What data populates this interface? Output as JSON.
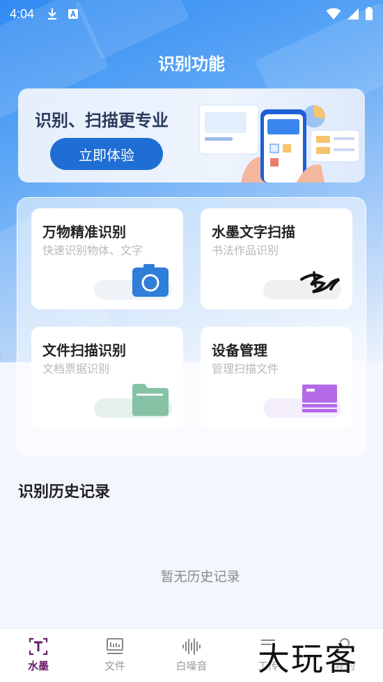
{
  "status_bar": {
    "time": "4:04",
    "left_icons": [
      "download-icon",
      "app-a-icon"
    ],
    "right_icons": [
      "wifi-icon",
      "signal-icon",
      "battery-icon"
    ]
  },
  "header": {
    "title": "识别功能"
  },
  "banner": {
    "title": "识别、扫描更专业",
    "button_label": "立即体验"
  },
  "features": [
    {
      "title": "万物精准识别",
      "subtitle": "快速识别物体、文字",
      "icon": "camera-icon",
      "accent": "#2f7ed8"
    },
    {
      "title": "水墨文字扫描",
      "subtitle": "书法作品识别",
      "icon": "ink-brush-icon",
      "accent": "#111111"
    },
    {
      "title": "文件扫描识别",
      "subtitle": "文档票据识别",
      "icon": "folder-icon",
      "accent": "#86c2a6"
    },
    {
      "title": "设备管理",
      "subtitle": "管理扫描文件",
      "icon": "device-card-icon",
      "accent": "#b46ae8"
    }
  ],
  "history": {
    "title": "识别历史记录",
    "empty_text": "暂无历史记录"
  },
  "tabbar": {
    "tabs": [
      {
        "label": "水墨",
        "icon": "text-tool-icon",
        "active": true
      },
      {
        "label": "文件",
        "icon": "document-icon",
        "active": false
      },
      {
        "label": "白噪音",
        "icon": "soundwave-icon",
        "active": false
      },
      {
        "label": "工传",
        "icon": "tool-icon",
        "active": false
      },
      {
        "label": "我的",
        "icon": "profile-icon",
        "active": false
      }
    ]
  },
  "watermark": "大玩客",
  "colors": {
    "primary": "#1f6ed4",
    "active_tab": "#6a1b6a"
  }
}
